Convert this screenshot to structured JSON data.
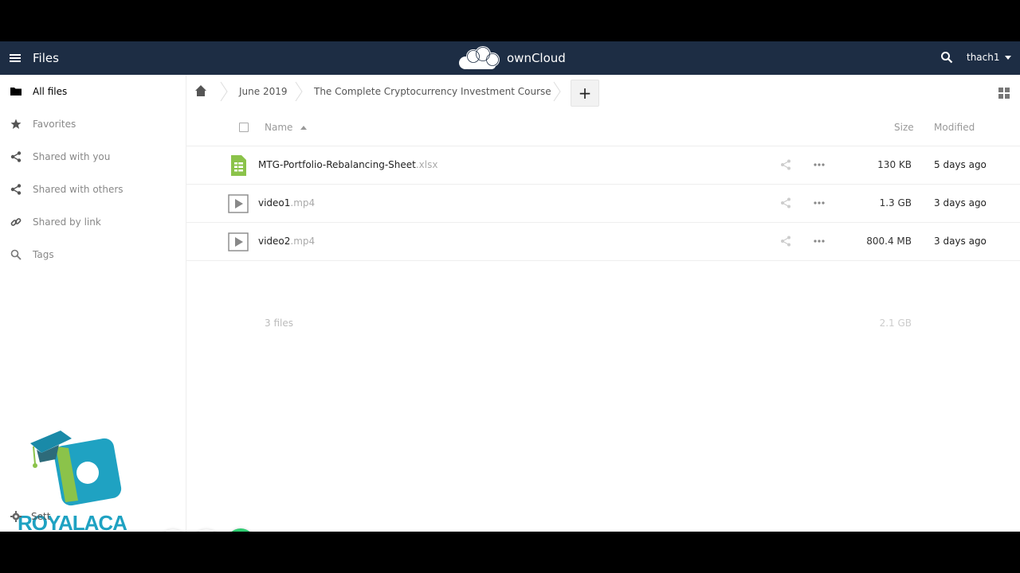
{
  "header": {
    "app_title": "Files",
    "brand": "ownCloud",
    "user": "thach1"
  },
  "sidebar": {
    "items": [
      {
        "label": "All files",
        "icon": "folder-icon"
      },
      {
        "label": "Favorites",
        "icon": "star-icon"
      },
      {
        "label": "Shared with you",
        "icon": "share-icon"
      },
      {
        "label": "Shared with others",
        "icon": "share-icon"
      },
      {
        "label": "Shared by link",
        "icon": "link-icon"
      },
      {
        "label": "Tags",
        "icon": "search-icon"
      }
    ],
    "settings_label": "Settings"
  },
  "watermark": {
    "text": "ROYALACA"
  },
  "breadcrumb": {
    "items": [
      "June 2019",
      "The Complete Cryptocurrency Investment Course"
    ],
    "new_label": "+"
  },
  "table": {
    "headers": {
      "name": "Name",
      "size": "Size",
      "modified": "Modified"
    },
    "rows": [
      {
        "name": "MTG-Portfolio-Rebalancing-Sheet",
        "ext": ".xlsx",
        "size": "130 KB",
        "modified": "5 days ago",
        "icon": "spreadsheet-icon"
      },
      {
        "name": "video1",
        "ext": ".mp4",
        "size": "1.3 GB",
        "modified": "3 days ago",
        "icon": "video-icon"
      },
      {
        "name": "video2",
        "ext": ".mp4",
        "size": "800.4 MB",
        "modified": "3 days ago",
        "icon": "video-icon"
      }
    ],
    "summary": {
      "count": "3 files",
      "total": "2.1 GB"
    }
  },
  "colors": {
    "header_bg": "#1d2d44",
    "spreadsheet_green": "#8bc34a",
    "confirm_green": "#2ecc71",
    "cancel_red": "#e57373",
    "watermark_teal": "#1fa2c2"
  }
}
